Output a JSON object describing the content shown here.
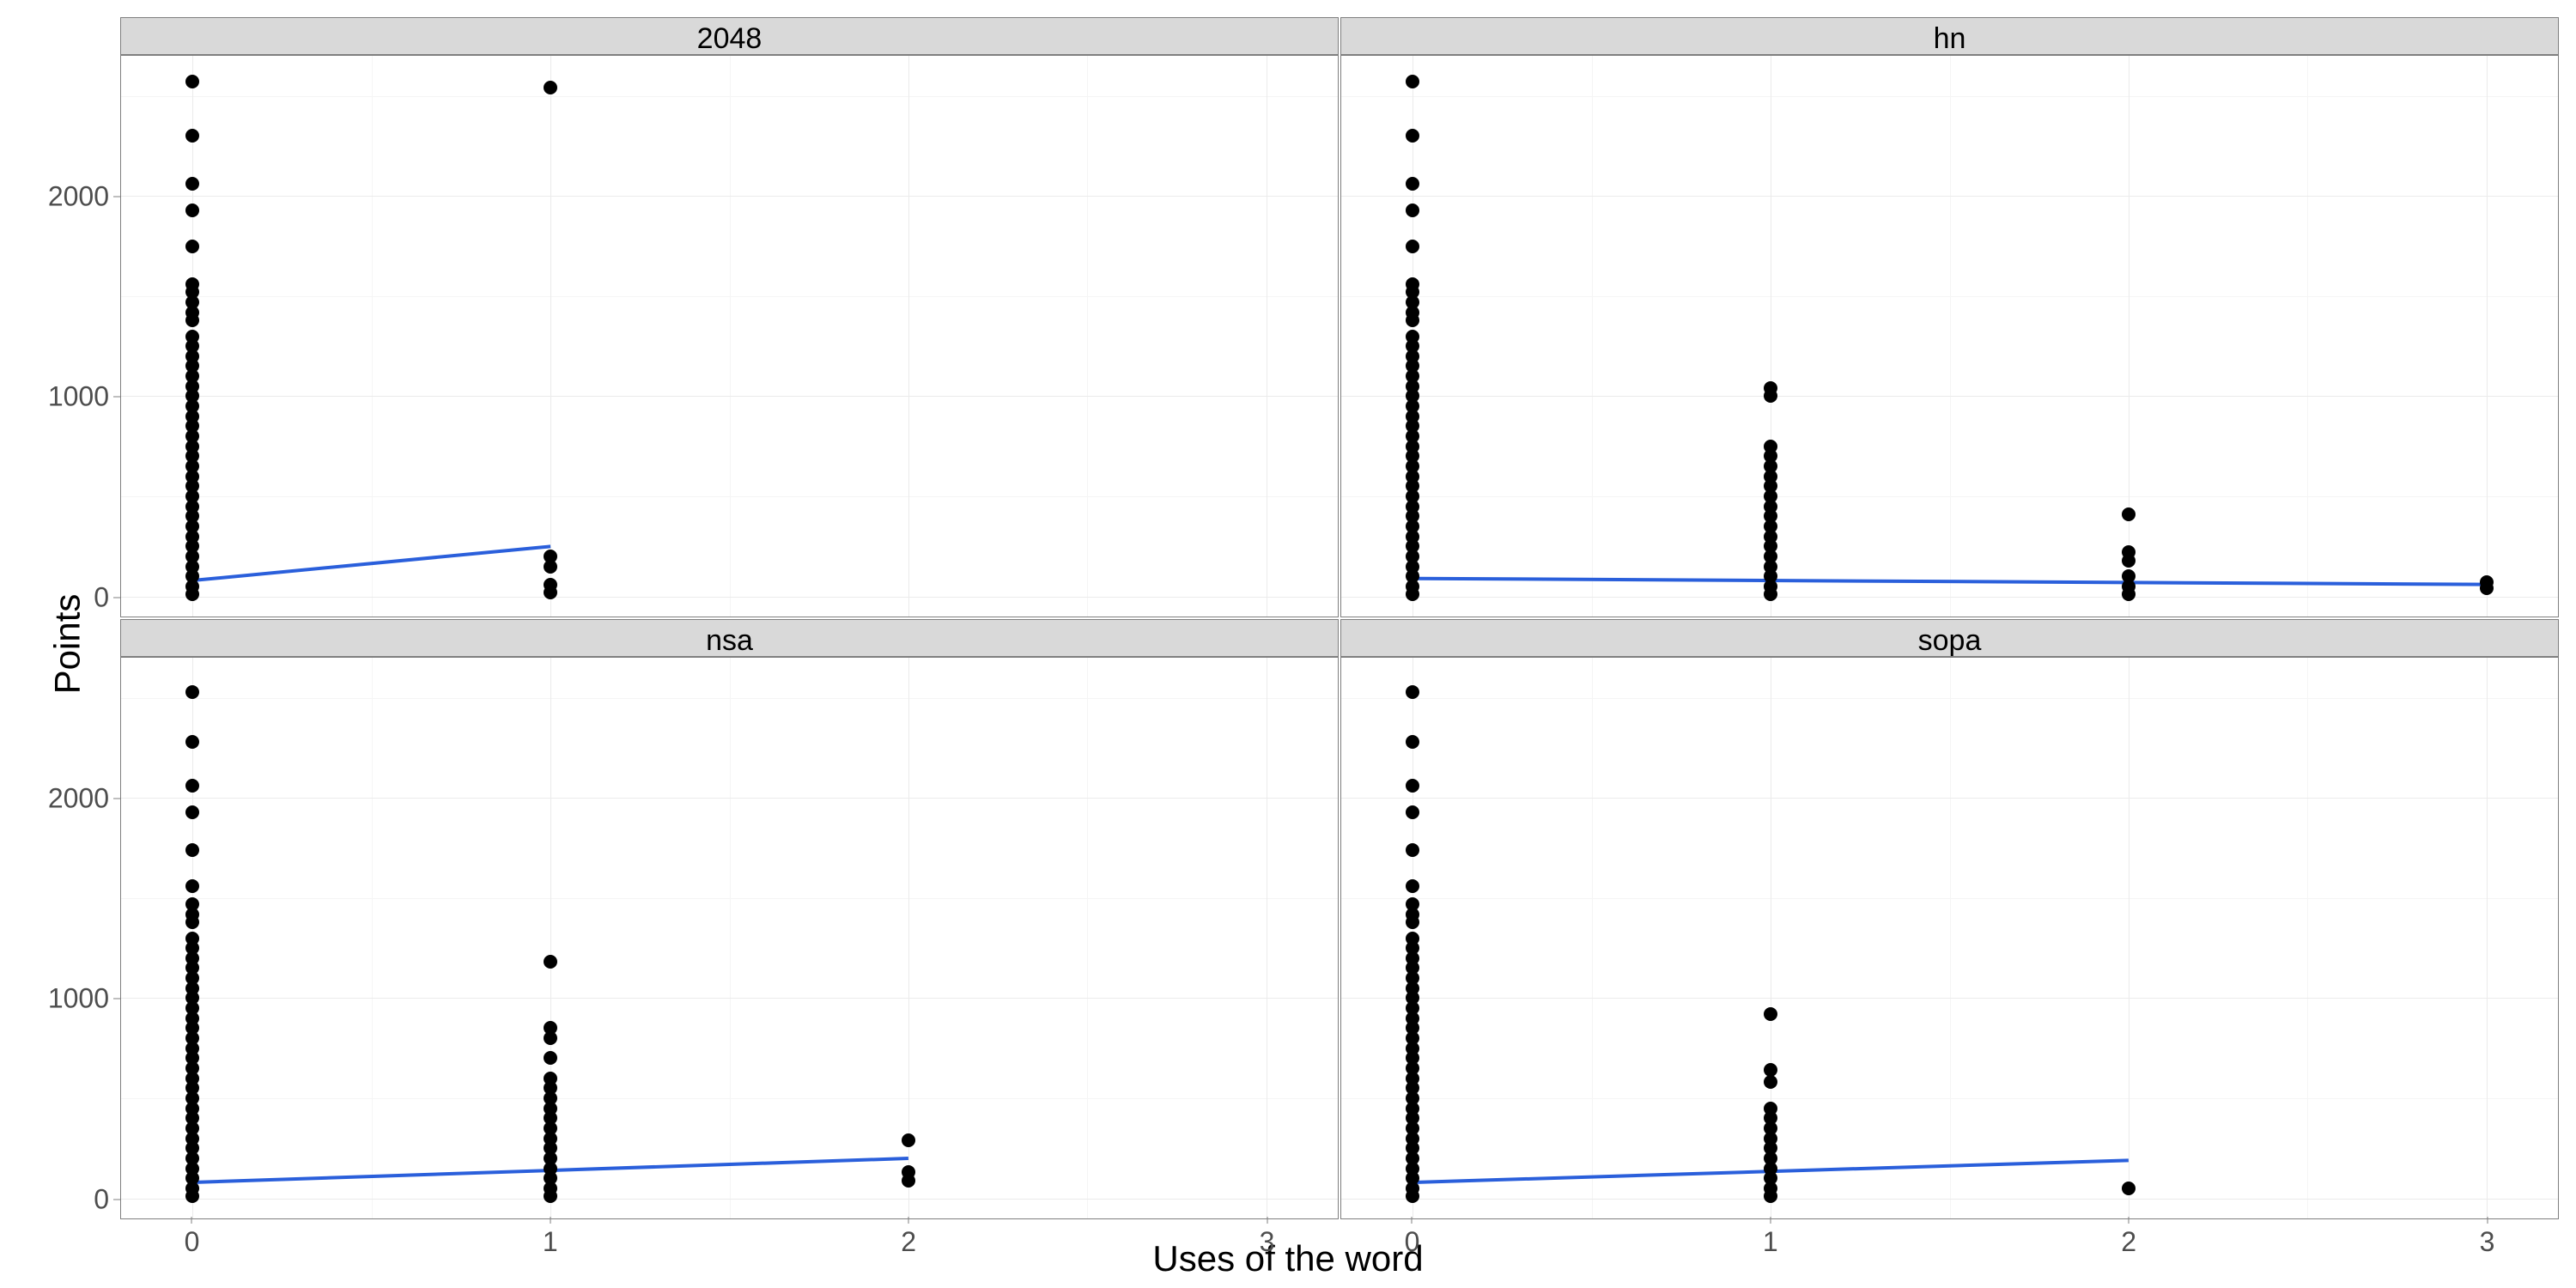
{
  "axis_labels": {
    "x": "Uses of the word",
    "y": "Points"
  },
  "facet_titles": [
    "2048",
    "hn",
    "nsa",
    "sopa"
  ],
  "y_ticks": [
    "0",
    "1000",
    "2000"
  ],
  "x_ticks": [
    "0",
    "1",
    "2",
    "3"
  ],
  "chart_data": [
    {
      "facet": "2048",
      "type": "scatter",
      "xlabel": "Uses of the word",
      "ylabel": "Points",
      "xlim": [
        -0.2,
        3.2
      ],
      "ylim": [
        -100,
        2700
      ],
      "trend": {
        "x1": 0,
        "y1": 80,
        "x2": 1,
        "y2": 250
      },
      "points": [
        {
          "x": 0,
          "y": 2570
        },
        {
          "x": 0,
          "y": 2300
        },
        {
          "x": 0,
          "y": 2060
        },
        {
          "x": 0,
          "y": 1930
        },
        {
          "x": 0,
          "y": 1750
        },
        {
          "x": 0,
          "y": 1560
        },
        {
          "x": 0,
          "y": 1520
        },
        {
          "x": 0,
          "y": 1470
        },
        {
          "x": 0,
          "y": 1420
        },
        {
          "x": 0,
          "y": 1380
        },
        {
          "x": 0,
          "y": 1300
        },
        {
          "x": 0,
          "y": 1250
        },
        {
          "x": 0,
          "y": 1200
        },
        {
          "x": 0,
          "y": 1150
        },
        {
          "x": 0,
          "y": 1100
        },
        {
          "x": 0,
          "y": 1050
        },
        {
          "x": 0,
          "y": 1000
        },
        {
          "x": 0,
          "y": 950
        },
        {
          "x": 0,
          "y": 900
        },
        {
          "x": 0,
          "y": 850
        },
        {
          "x": 0,
          "y": 800
        },
        {
          "x": 0,
          "y": 750
        },
        {
          "x": 0,
          "y": 700
        },
        {
          "x": 0,
          "y": 650
        },
        {
          "x": 0,
          "y": 600
        },
        {
          "x": 0,
          "y": 550
        },
        {
          "x": 0,
          "y": 500
        },
        {
          "x": 0,
          "y": 450
        },
        {
          "x": 0,
          "y": 400
        },
        {
          "x": 0,
          "y": 350
        },
        {
          "x": 0,
          "y": 300
        },
        {
          "x": 0,
          "y": 250
        },
        {
          "x": 0,
          "y": 200
        },
        {
          "x": 0,
          "y": 150
        },
        {
          "x": 0,
          "y": 100
        },
        {
          "x": 0,
          "y": 50
        },
        {
          "x": 0,
          "y": 10
        },
        {
          "x": 1,
          "y": 2540
        },
        {
          "x": 1,
          "y": 200
        },
        {
          "x": 1,
          "y": 150
        },
        {
          "x": 1,
          "y": 60
        },
        {
          "x": 1,
          "y": 20
        }
      ]
    },
    {
      "facet": "hn",
      "type": "scatter",
      "xlabel": "Uses of the word",
      "ylabel": "Points",
      "xlim": [
        -0.2,
        3.2
      ],
      "ylim": [
        -100,
        2700
      ],
      "trend": {
        "x1": 0,
        "y1": 90,
        "x2": 3,
        "y2": 60
      },
      "points": [
        {
          "x": 0,
          "y": 2570
        },
        {
          "x": 0,
          "y": 2300
        },
        {
          "x": 0,
          "y": 2060
        },
        {
          "x": 0,
          "y": 1930
        },
        {
          "x": 0,
          "y": 1750
        },
        {
          "x": 0,
          "y": 1560
        },
        {
          "x": 0,
          "y": 1520
        },
        {
          "x": 0,
          "y": 1470
        },
        {
          "x": 0,
          "y": 1420
        },
        {
          "x": 0,
          "y": 1380
        },
        {
          "x": 0,
          "y": 1300
        },
        {
          "x": 0,
          "y": 1250
        },
        {
          "x": 0,
          "y": 1200
        },
        {
          "x": 0,
          "y": 1150
        },
        {
          "x": 0,
          "y": 1100
        },
        {
          "x": 0,
          "y": 1050
        },
        {
          "x": 0,
          "y": 1000
        },
        {
          "x": 0,
          "y": 950
        },
        {
          "x": 0,
          "y": 900
        },
        {
          "x": 0,
          "y": 850
        },
        {
          "x": 0,
          "y": 800
        },
        {
          "x": 0,
          "y": 750
        },
        {
          "x": 0,
          "y": 700
        },
        {
          "x": 0,
          "y": 650
        },
        {
          "x": 0,
          "y": 600
        },
        {
          "x": 0,
          "y": 550
        },
        {
          "x": 0,
          "y": 500
        },
        {
          "x": 0,
          "y": 450
        },
        {
          "x": 0,
          "y": 400
        },
        {
          "x": 0,
          "y": 350
        },
        {
          "x": 0,
          "y": 300
        },
        {
          "x": 0,
          "y": 250
        },
        {
          "x": 0,
          "y": 200
        },
        {
          "x": 0,
          "y": 150
        },
        {
          "x": 0,
          "y": 100
        },
        {
          "x": 0,
          "y": 50
        },
        {
          "x": 0,
          "y": 10
        },
        {
          "x": 1,
          "y": 1040
        },
        {
          "x": 1,
          "y": 1000
        },
        {
          "x": 1,
          "y": 750
        },
        {
          "x": 1,
          "y": 700
        },
        {
          "x": 1,
          "y": 650
        },
        {
          "x": 1,
          "y": 600
        },
        {
          "x": 1,
          "y": 550
        },
        {
          "x": 1,
          "y": 500
        },
        {
          "x": 1,
          "y": 450
        },
        {
          "x": 1,
          "y": 400
        },
        {
          "x": 1,
          "y": 350
        },
        {
          "x": 1,
          "y": 300
        },
        {
          "x": 1,
          "y": 250
        },
        {
          "x": 1,
          "y": 200
        },
        {
          "x": 1,
          "y": 150
        },
        {
          "x": 1,
          "y": 100
        },
        {
          "x": 1,
          "y": 50
        },
        {
          "x": 1,
          "y": 10
        },
        {
          "x": 2,
          "y": 410
        },
        {
          "x": 2,
          "y": 220
        },
        {
          "x": 2,
          "y": 180
        },
        {
          "x": 2,
          "y": 100
        },
        {
          "x": 2,
          "y": 50
        },
        {
          "x": 2,
          "y": 10
        },
        {
          "x": 3,
          "y": 70
        },
        {
          "x": 3,
          "y": 40
        }
      ]
    },
    {
      "facet": "nsa",
      "type": "scatter",
      "xlabel": "Uses of the word",
      "ylabel": "Points",
      "xlim": [
        -0.2,
        3.2
      ],
      "ylim": [
        -100,
        2700
      ],
      "trend": {
        "x1": 0,
        "y1": 80,
        "x2": 2,
        "y2": 200
      },
      "points": [
        {
          "x": 0,
          "y": 2530
        },
        {
          "x": 0,
          "y": 2280
        },
        {
          "x": 0,
          "y": 2060
        },
        {
          "x": 0,
          "y": 1930
        },
        {
          "x": 0,
          "y": 1740
        },
        {
          "x": 0,
          "y": 1560
        },
        {
          "x": 0,
          "y": 1470
        },
        {
          "x": 0,
          "y": 1420
        },
        {
          "x": 0,
          "y": 1380
        },
        {
          "x": 0,
          "y": 1300
        },
        {
          "x": 0,
          "y": 1250
        },
        {
          "x": 0,
          "y": 1200
        },
        {
          "x": 0,
          "y": 1150
        },
        {
          "x": 0,
          "y": 1100
        },
        {
          "x": 0,
          "y": 1050
        },
        {
          "x": 0,
          "y": 1000
        },
        {
          "x": 0,
          "y": 950
        },
        {
          "x": 0,
          "y": 900
        },
        {
          "x": 0,
          "y": 850
        },
        {
          "x": 0,
          "y": 800
        },
        {
          "x": 0,
          "y": 750
        },
        {
          "x": 0,
          "y": 700
        },
        {
          "x": 0,
          "y": 650
        },
        {
          "x": 0,
          "y": 600
        },
        {
          "x": 0,
          "y": 550
        },
        {
          "x": 0,
          "y": 500
        },
        {
          "x": 0,
          "y": 450
        },
        {
          "x": 0,
          "y": 400
        },
        {
          "x": 0,
          "y": 350
        },
        {
          "x": 0,
          "y": 300
        },
        {
          "x": 0,
          "y": 250
        },
        {
          "x": 0,
          "y": 200
        },
        {
          "x": 0,
          "y": 150
        },
        {
          "x": 0,
          "y": 100
        },
        {
          "x": 0,
          "y": 50
        },
        {
          "x": 0,
          "y": 10
        },
        {
          "x": 1,
          "y": 1180
        },
        {
          "x": 1,
          "y": 850
        },
        {
          "x": 1,
          "y": 800
        },
        {
          "x": 1,
          "y": 700
        },
        {
          "x": 1,
          "y": 600
        },
        {
          "x": 1,
          "y": 550
        },
        {
          "x": 1,
          "y": 500
        },
        {
          "x": 1,
          "y": 450
        },
        {
          "x": 1,
          "y": 400
        },
        {
          "x": 1,
          "y": 350
        },
        {
          "x": 1,
          "y": 300
        },
        {
          "x": 1,
          "y": 250
        },
        {
          "x": 1,
          "y": 200
        },
        {
          "x": 1,
          "y": 150
        },
        {
          "x": 1,
          "y": 100
        },
        {
          "x": 1,
          "y": 50
        },
        {
          "x": 1,
          "y": 10
        },
        {
          "x": 2,
          "y": 290
        },
        {
          "x": 2,
          "y": 130
        },
        {
          "x": 2,
          "y": 90
        }
      ]
    },
    {
      "facet": "sopa",
      "type": "scatter",
      "xlabel": "Uses of the word",
      "ylabel": "Points",
      "xlim": [
        -0.2,
        3.2
      ],
      "ylim": [
        -100,
        2700
      ],
      "trend": {
        "x1": 0,
        "y1": 80,
        "x2": 2,
        "y2": 190
      },
      "points": [
        {
          "x": 0,
          "y": 2530
        },
        {
          "x": 0,
          "y": 2280
        },
        {
          "x": 0,
          "y": 2060
        },
        {
          "x": 0,
          "y": 1930
        },
        {
          "x": 0,
          "y": 1740
        },
        {
          "x": 0,
          "y": 1560
        },
        {
          "x": 0,
          "y": 1470
        },
        {
          "x": 0,
          "y": 1420
        },
        {
          "x": 0,
          "y": 1380
        },
        {
          "x": 0,
          "y": 1300
        },
        {
          "x": 0,
          "y": 1250
        },
        {
          "x": 0,
          "y": 1200
        },
        {
          "x": 0,
          "y": 1150
        },
        {
          "x": 0,
          "y": 1100
        },
        {
          "x": 0,
          "y": 1050
        },
        {
          "x": 0,
          "y": 1000
        },
        {
          "x": 0,
          "y": 950
        },
        {
          "x": 0,
          "y": 900
        },
        {
          "x": 0,
          "y": 850
        },
        {
          "x": 0,
          "y": 800
        },
        {
          "x": 0,
          "y": 750
        },
        {
          "x": 0,
          "y": 700
        },
        {
          "x": 0,
          "y": 650
        },
        {
          "x": 0,
          "y": 600
        },
        {
          "x": 0,
          "y": 550
        },
        {
          "x": 0,
          "y": 500
        },
        {
          "x": 0,
          "y": 450
        },
        {
          "x": 0,
          "y": 400
        },
        {
          "x": 0,
          "y": 350
        },
        {
          "x": 0,
          "y": 300
        },
        {
          "x": 0,
          "y": 250
        },
        {
          "x": 0,
          "y": 200
        },
        {
          "x": 0,
          "y": 150
        },
        {
          "x": 0,
          "y": 100
        },
        {
          "x": 0,
          "y": 50
        },
        {
          "x": 0,
          "y": 10
        },
        {
          "x": 1,
          "y": 920
        },
        {
          "x": 1,
          "y": 640
        },
        {
          "x": 1,
          "y": 580
        },
        {
          "x": 1,
          "y": 450
        },
        {
          "x": 1,
          "y": 400
        },
        {
          "x": 1,
          "y": 350
        },
        {
          "x": 1,
          "y": 300
        },
        {
          "x": 1,
          "y": 250
        },
        {
          "x": 1,
          "y": 200
        },
        {
          "x": 1,
          "y": 150
        },
        {
          "x": 1,
          "y": 100
        },
        {
          "x": 1,
          "y": 50
        },
        {
          "x": 1,
          "y": 10
        },
        {
          "x": 2,
          "y": 50
        }
      ]
    }
  ]
}
